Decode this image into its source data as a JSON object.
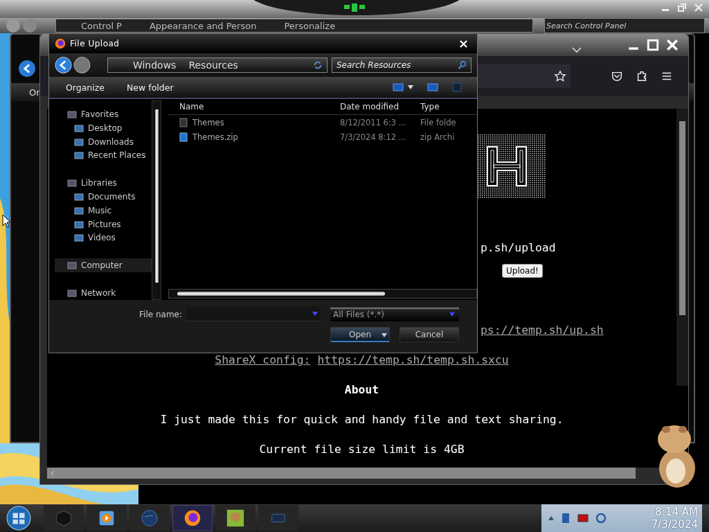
{
  "control_panel": {
    "breadcrumbs": [
      "Control P",
      "Appearance and Person",
      "Personalize"
    ],
    "search": {
      "placeholder": "Search Control Panel"
    }
  },
  "side_window": {
    "toolbar_label": "Or"
  },
  "browser": {
    "page": {
      "upload_hint": "p.sh/upload",
      "upload_button": "Upload!",
      "script_link": "ps://temp.sh/up.sh",
      "sharex_label": "ShareX config:",
      "sharex_link": "https://temp.sh/temp.sh.sxcu",
      "heading": "About",
      "paragraphs": [
        "I just made this for quick and handy file and text sharing.",
        "Current file size limit is 4GB"
      ]
    }
  },
  "file_dialog": {
    "title": "File Upload",
    "path": [
      "Windows",
      "Resources"
    ],
    "search": {
      "placeholder": "Search Resources"
    },
    "toolbar": [
      "Organize",
      "New folder"
    ],
    "nav": [
      {
        "label": "Favorites",
        "selected": false,
        "children": [
          {
            "label": "Desktop",
            "selected": false
          },
          {
            "label": "Downloads",
            "selected": false
          },
          {
            "label": "Recent Places",
            "selected": false
          }
        ]
      },
      {
        "label": "Libraries",
        "selected": false,
        "children": [
          {
            "label": "Documents",
            "selected": false
          },
          {
            "label": "Music",
            "selected": false
          },
          {
            "label": "Pictures",
            "selected": false
          },
          {
            "label": "Videos",
            "selected": false
          }
        ]
      },
      {
        "label": "Computer",
        "selected": true
      },
      {
        "label": "Network",
        "selected": false
      }
    ],
    "columns": [
      "Name",
      "Date modified",
      "Type"
    ],
    "files": [
      {
        "kind": "folder",
        "name": "Themes",
        "date": "8/12/2011 6:3 ...",
        "type": "File folde"
      },
      {
        "kind": "zip",
        "name": "Themes.zip",
        "date": "7/3/2024 8:12 ...",
        "type": "zip Archi"
      }
    ],
    "file_name_label": "File name:",
    "file_type": "All Files (*.*)",
    "buttons": [
      "Open",
      "Cancel"
    ]
  },
  "taskbar": {
    "items": [
      {
        "kind": "cube",
        "selected": false
      },
      {
        "kind": "media",
        "selected": false
      },
      {
        "kind": "globe",
        "selected": false
      },
      {
        "kind": "firefox",
        "selected": true
      },
      {
        "kind": "game",
        "selected": false
      },
      {
        "kind": "screen",
        "selected": false
      }
    ],
    "clock": {
      "time": "8:14 AM",
      "date": "7/3/2024"
    }
  }
}
